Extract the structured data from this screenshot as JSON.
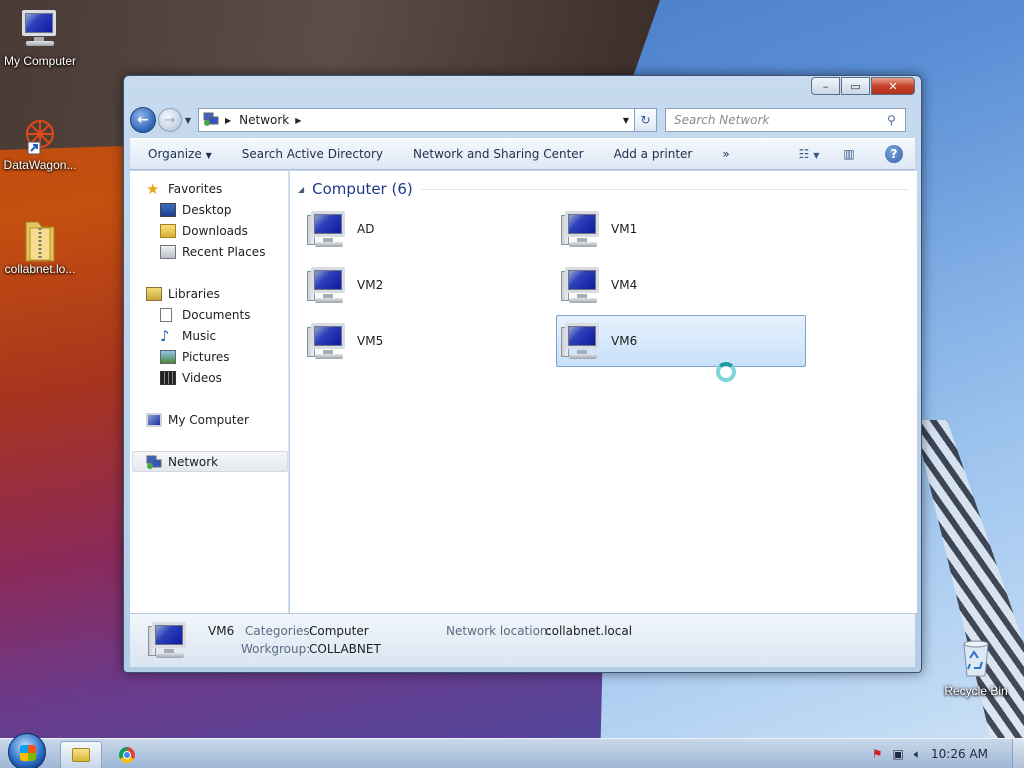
{
  "desktop": {
    "icons": [
      {
        "label": "My Computer"
      },
      {
        "label": "DataWagon..."
      },
      {
        "label": "collabnet.lo..."
      },
      {
        "label": "Recycle Bin"
      }
    ]
  },
  "window": {
    "caption": {
      "minimize": "–",
      "restore": "▭",
      "close": "✕"
    },
    "address": {
      "crumb": "Network"
    },
    "search": {
      "placeholder": "Search Network"
    },
    "commands": [
      "Organize",
      "Search Active Directory",
      "Network and Sharing Center",
      "Add a printer",
      "»"
    ],
    "nav_pane": {
      "favorites": "Favorites",
      "favorites_items": [
        "Desktop",
        "Downloads",
        "Recent Places"
      ],
      "libraries": "Libraries",
      "libraries_items": [
        "Documents",
        "Music",
        "Pictures",
        "Videos"
      ],
      "my_computer": "My Computer",
      "network": "Network"
    },
    "group": {
      "title": "Computer (6)"
    },
    "computers": [
      "AD",
      "VM1",
      "VM2",
      "VM4",
      "VM5",
      "VM6"
    ],
    "selected": "VM6",
    "details": {
      "name": "VM6",
      "categories_label": "Categories:",
      "categories_value": "Computer",
      "workgroup_label": "Workgroup:",
      "workgroup_value": "COLLABNET",
      "location_label": "Network location:",
      "location_value": "collabnet.local"
    }
  },
  "taskbar": {
    "time": "10:26 AM"
  },
  "colors": {
    "selection_bg": "#cde4fb",
    "group_title": "#1e3a8a",
    "window_frame": "#b9d1ea"
  }
}
